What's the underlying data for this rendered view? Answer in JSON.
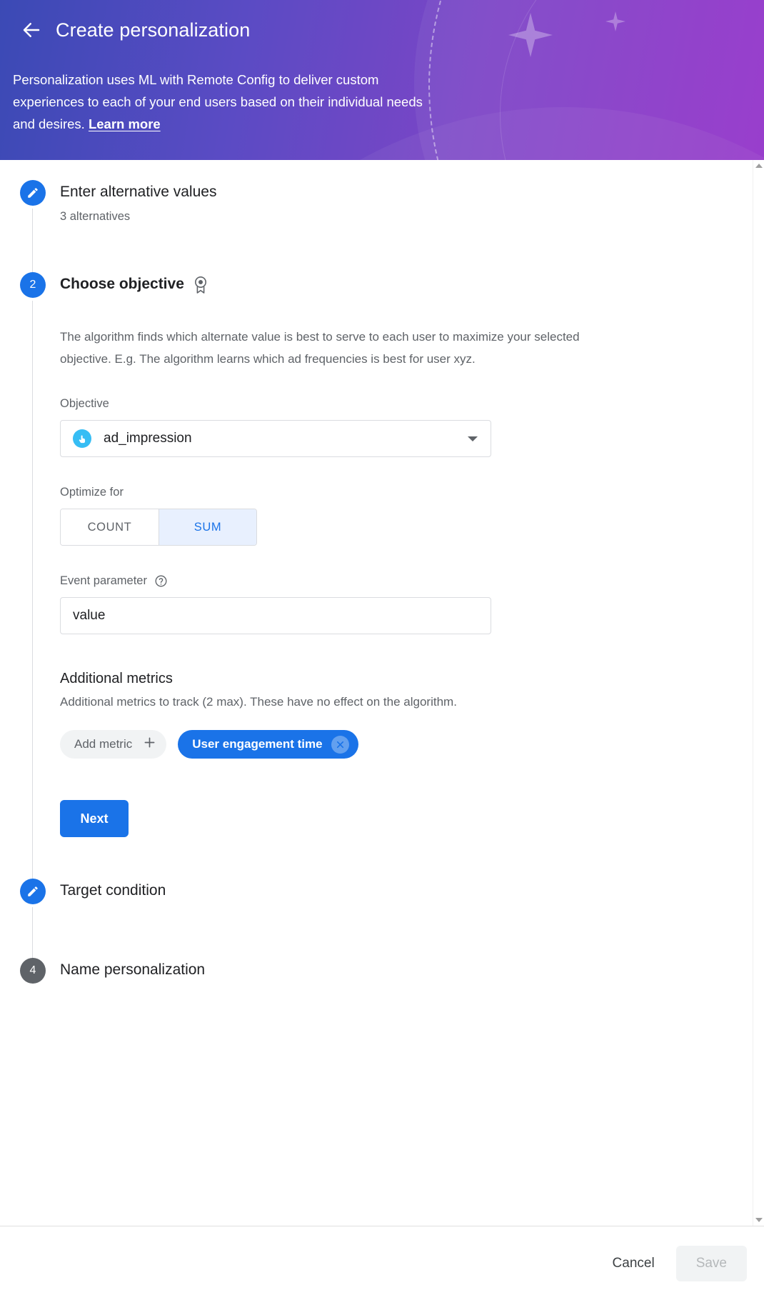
{
  "header": {
    "back_icon": "back-arrow-icon",
    "title": "Create personalization",
    "description": "Personalization uses ML with Remote Config to deliver custom experiences to each of your end users based on their individual needs and desires. ",
    "learn_more": "Learn more",
    "gradient_from": "#3b4ab5",
    "gradient_to": "#9333c9"
  },
  "steps": {
    "step1": {
      "bullet_icon": "pencil-icon",
      "title": "Enter alternative values",
      "subtitle": "3 alternatives"
    },
    "step2": {
      "bullet_number": "2",
      "title": "Choose objective",
      "title_icon": "award-badge-icon",
      "description": "The algorithm finds which alternate value is best to serve to each user to maximize your selected objective. E.g. The algorithm learns which ad frequencies is best for user xyz.",
      "objective": {
        "label": "Objective",
        "icon": "tap-touch-icon",
        "value": "ad_impression",
        "caret_icon": "chevron-down-icon"
      },
      "optimize_for": {
        "label": "Optimize for",
        "options": [
          "COUNT",
          "SUM"
        ],
        "selected": "SUM"
      },
      "event_parameter": {
        "label": "Event parameter",
        "help_icon": "help-circle-icon",
        "value": "value",
        "placeholder": "value"
      },
      "additional_metrics": {
        "title": "Additional metrics",
        "description": "Additional metrics to track (2 max). These have no effect on the algorithm.",
        "add_chip_label": "Add metric",
        "add_chip_icon": "plus-icon",
        "selected_chips": [
          {
            "label": "User engagement time",
            "remove_icon": "close-circle-icon"
          }
        ]
      },
      "next_button": "Next"
    },
    "step3": {
      "bullet_icon": "pencil-icon",
      "title": "Target condition"
    },
    "step4": {
      "bullet_number": "4",
      "title": "Name personalization"
    }
  },
  "footer": {
    "cancel_label": "Cancel",
    "save_label": "Save"
  },
  "scrollbar": {
    "up_icon": "scroll-up-arrow-icon",
    "down_icon": "scroll-down-arrow-icon"
  },
  "colors": {
    "accent_blue": "#1a73e8",
    "muted_gray": "#5f6368",
    "selected_toggle_bg": "#e8f0fe",
    "objective_icon_bg": "#36bdf4",
    "pending_bullet": "#5f6368"
  }
}
